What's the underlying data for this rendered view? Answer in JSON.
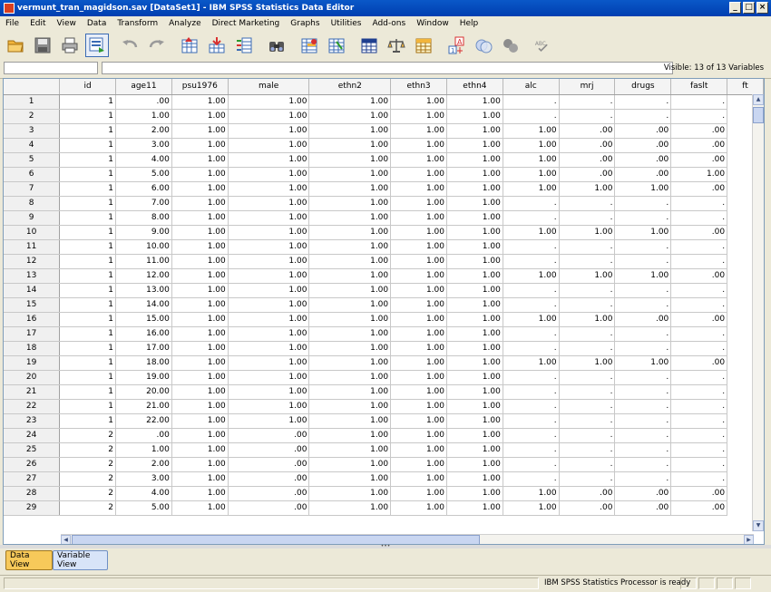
{
  "window": {
    "title": "vermunt_tran_magidson.sav [DataSet1] - IBM SPSS Statistics Data Editor",
    "minimize": "_",
    "maximize": "□",
    "close": "×"
  },
  "menu": [
    "File",
    "Edit",
    "View",
    "Data",
    "Transform",
    "Analyze",
    "Direct Marketing",
    "Graphs",
    "Utilities",
    "Add-ons",
    "Window",
    "Help"
  ],
  "toolbar": {
    "icons": [
      "open-folder-icon",
      "save-icon",
      "print-icon",
      "recall-dialog-icon",
      "undo-icon",
      "redo-icon",
      "go-to-case-icon",
      "go-to-variable-icon",
      "variables-icon",
      "find-icon",
      "insert-cases-icon",
      "insert-variable-icon",
      "split-file-icon",
      "weight-cases-icon",
      "select-cases-icon",
      "value-labels-icon",
      "use-sets-icon",
      "show-all-variables-icon",
      "spell-check-icon"
    ],
    "spell_label": "ABC"
  },
  "editbar": {
    "visible_label": "Visible: 13 of 13 Variables"
  },
  "grid": {
    "columns": [
      "id",
      "age11",
      "psu1976",
      "male",
      "ethn2",
      "ethn3",
      "ethn4",
      "alc",
      "mrj",
      "drugs",
      "faslt",
      "ft"
    ],
    "rows": [
      [
        "1",
        "1",
        ".00",
        "1.00",
        "1.00",
        "1.00",
        "1.00",
        "1.00",
        ".",
        ".",
        ".",
        "."
      ],
      [
        "2",
        "1",
        "1.00",
        "1.00",
        "1.00",
        "1.00",
        "1.00",
        "1.00",
        ".",
        ".",
        ".",
        "."
      ],
      [
        "3",
        "1",
        "2.00",
        "1.00",
        "1.00",
        "1.00",
        "1.00",
        "1.00",
        "1.00",
        ".00",
        ".00",
        ".00"
      ],
      [
        "4",
        "1",
        "3.00",
        "1.00",
        "1.00",
        "1.00",
        "1.00",
        "1.00",
        "1.00",
        ".00",
        ".00",
        ".00"
      ],
      [
        "5",
        "1",
        "4.00",
        "1.00",
        "1.00",
        "1.00",
        "1.00",
        "1.00",
        "1.00",
        ".00",
        ".00",
        ".00"
      ],
      [
        "6",
        "1",
        "5.00",
        "1.00",
        "1.00",
        "1.00",
        "1.00",
        "1.00",
        "1.00",
        ".00",
        ".00",
        "1.00"
      ],
      [
        "7",
        "1",
        "6.00",
        "1.00",
        "1.00",
        "1.00",
        "1.00",
        "1.00",
        "1.00",
        "1.00",
        "1.00",
        ".00"
      ],
      [
        "8",
        "1",
        "7.00",
        "1.00",
        "1.00",
        "1.00",
        "1.00",
        "1.00",
        ".",
        ".",
        ".",
        "."
      ],
      [
        "9",
        "1",
        "8.00",
        "1.00",
        "1.00",
        "1.00",
        "1.00",
        "1.00",
        ".",
        ".",
        ".",
        "."
      ],
      [
        "10",
        "1",
        "9.00",
        "1.00",
        "1.00",
        "1.00",
        "1.00",
        "1.00",
        "1.00",
        "1.00",
        "1.00",
        ".00"
      ],
      [
        "11",
        "1",
        "10.00",
        "1.00",
        "1.00",
        "1.00",
        "1.00",
        "1.00",
        ".",
        ".",
        ".",
        "."
      ],
      [
        "12",
        "1",
        "11.00",
        "1.00",
        "1.00",
        "1.00",
        "1.00",
        "1.00",
        ".",
        ".",
        ".",
        "."
      ],
      [
        "13",
        "1",
        "12.00",
        "1.00",
        "1.00",
        "1.00",
        "1.00",
        "1.00",
        "1.00",
        "1.00",
        "1.00",
        ".00"
      ],
      [
        "14",
        "1",
        "13.00",
        "1.00",
        "1.00",
        "1.00",
        "1.00",
        "1.00",
        ".",
        ".",
        ".",
        "."
      ],
      [
        "15",
        "1",
        "14.00",
        "1.00",
        "1.00",
        "1.00",
        "1.00",
        "1.00",
        ".",
        ".",
        ".",
        "."
      ],
      [
        "16",
        "1",
        "15.00",
        "1.00",
        "1.00",
        "1.00",
        "1.00",
        "1.00",
        "1.00",
        "1.00",
        ".00",
        ".00"
      ],
      [
        "17",
        "1",
        "16.00",
        "1.00",
        "1.00",
        "1.00",
        "1.00",
        "1.00",
        ".",
        ".",
        ".",
        "."
      ],
      [
        "18",
        "1",
        "17.00",
        "1.00",
        "1.00",
        "1.00",
        "1.00",
        "1.00",
        ".",
        ".",
        ".",
        "."
      ],
      [
        "19",
        "1",
        "18.00",
        "1.00",
        "1.00",
        "1.00",
        "1.00",
        "1.00",
        "1.00",
        "1.00",
        "1.00",
        ".00"
      ],
      [
        "20",
        "1",
        "19.00",
        "1.00",
        "1.00",
        "1.00",
        "1.00",
        "1.00",
        ".",
        ".",
        ".",
        "."
      ],
      [
        "21",
        "1",
        "20.00",
        "1.00",
        "1.00",
        "1.00",
        "1.00",
        "1.00",
        ".",
        ".",
        ".",
        "."
      ],
      [
        "22",
        "1",
        "21.00",
        "1.00",
        "1.00",
        "1.00",
        "1.00",
        "1.00",
        ".",
        ".",
        ".",
        "."
      ],
      [
        "23",
        "1",
        "22.00",
        "1.00",
        "1.00",
        "1.00",
        "1.00",
        "1.00",
        ".",
        ".",
        ".",
        "."
      ],
      [
        "24",
        "2",
        ".00",
        "1.00",
        ".00",
        "1.00",
        "1.00",
        "1.00",
        ".",
        ".",
        ".",
        "."
      ],
      [
        "25",
        "2",
        "1.00",
        "1.00",
        ".00",
        "1.00",
        "1.00",
        "1.00",
        ".",
        ".",
        ".",
        "."
      ],
      [
        "26",
        "2",
        "2.00",
        "1.00",
        ".00",
        "1.00",
        "1.00",
        "1.00",
        ".",
        ".",
        ".",
        "."
      ],
      [
        "27",
        "2",
        "3.00",
        "1.00",
        ".00",
        "1.00",
        "1.00",
        "1.00",
        ".",
        ".",
        ".",
        "."
      ],
      [
        "28",
        "2",
        "4.00",
        "1.00",
        ".00",
        "1.00",
        "1.00",
        "1.00",
        "1.00",
        ".00",
        ".00",
        ".00"
      ],
      [
        "29",
        "2",
        "5.00",
        "1.00",
        ".00",
        "1.00",
        "1.00",
        "1.00",
        "1.00",
        ".00",
        ".00",
        ".00"
      ]
    ]
  },
  "tabs": {
    "data_view": "Data View",
    "variable_view": "Variable View"
  },
  "status": {
    "message": "IBM SPSS Statistics Processor is ready"
  },
  "colors": {
    "title_bar": "#0a58c8",
    "active_tab": "#f7c95a",
    "inactive_tab": "#d8e4f8"
  }
}
